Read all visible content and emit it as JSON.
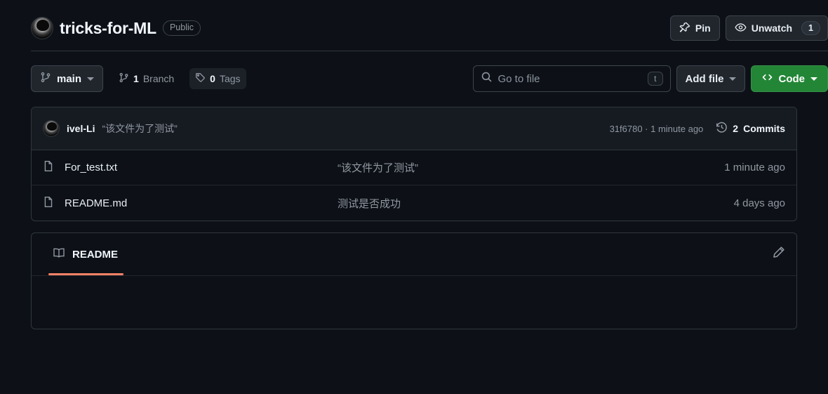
{
  "header": {
    "repo_name": "tricks-for-ML",
    "visibility": "Public",
    "avatar_icon": "user-avatar",
    "pin_label": "Pin",
    "pin_icon": "pin-icon",
    "watch_label": "Unwatch",
    "watch_icon": "eye-icon",
    "watch_count": "1"
  },
  "toolbar": {
    "branch_name": "main",
    "branch_icon": "git-branch-icon",
    "branch_count_label": "Branch",
    "branch_count": "1",
    "tag_icon": "tag-icon",
    "tag_count": "0",
    "tag_count_label": "Tags",
    "search_placeholder": "Go to file",
    "search_value": "",
    "search_icon": "search-icon",
    "search_shortcut": "t",
    "add_file_label": "Add file",
    "code_label": "Code",
    "code_icon": "code-brackets-icon"
  },
  "commit_bar": {
    "author": "ivel-Li",
    "author_avatar_icon": "user-avatar",
    "message": "“该文件为了测试”",
    "hash_and_time": "31f6780 · 1 minute ago",
    "commits_count": "2",
    "commits_label": "Commits",
    "history_icon": "history-clock-icon"
  },
  "files": [
    {
      "icon": "file-icon",
      "name": "For_test.txt",
      "message": "“该文件为了测试”",
      "time": "1 minute ago"
    },
    {
      "icon": "file-icon",
      "name": "README.md",
      "message": "测试是否成功",
      "time": "4 days ago"
    }
  ],
  "readme": {
    "tab_label": "README",
    "tab_icon": "book-icon",
    "edit_icon": "pencil-icon",
    "body": ""
  },
  "colors": {
    "page_bg": "#0d1117",
    "panel_bg": "#161b22",
    "border": "#30363d",
    "accent_green": "#238636",
    "tab_underline": "#f78166",
    "muted_text": "#9198a1"
  }
}
